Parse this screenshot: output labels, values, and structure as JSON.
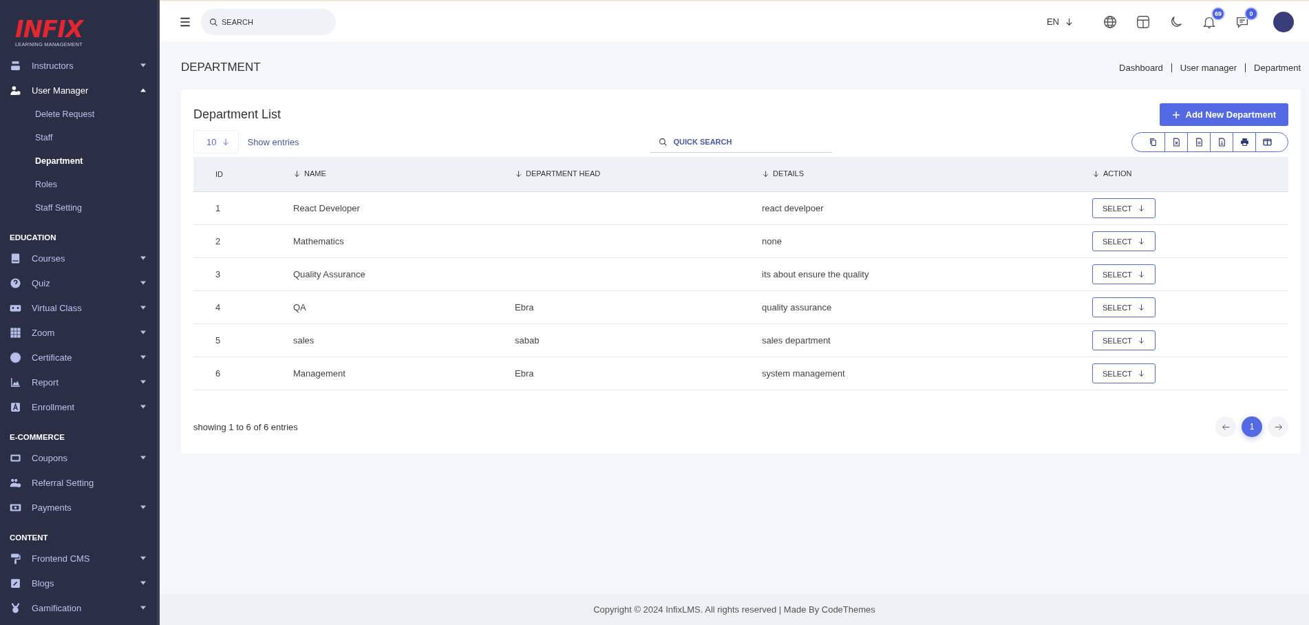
{
  "logo": {
    "title": "INFIX",
    "subtitle": "LEARNING MANAGEMENT"
  },
  "sidebar": {
    "sections": [
      {
        "items": [
          {
            "label": "Instructors",
            "expandable": true,
            "expanded": false
          },
          {
            "label": "User Manager",
            "expandable": true,
            "expanded": true,
            "children": [
              {
                "label": "Delete Request",
                "selected": false
              },
              {
                "label": "Staff",
                "selected": false
              },
              {
                "label": "Department",
                "selected": true
              },
              {
                "label": "Roles",
                "selected": false
              },
              {
                "label": "Staff Setting",
                "selected": false
              }
            ]
          }
        ]
      },
      {
        "title": "EDUCATION",
        "items": [
          {
            "label": "Courses",
            "expandable": true,
            "expanded": false
          },
          {
            "label": "Quiz",
            "expandable": true,
            "expanded": false
          },
          {
            "label": "Virtual Class",
            "expandable": true,
            "expanded": false
          },
          {
            "label": "Zoom",
            "expandable": true,
            "expanded": false
          },
          {
            "label": "Certificate",
            "expandable": true,
            "expanded": false
          },
          {
            "label": "Report",
            "expandable": true,
            "expanded": false
          },
          {
            "label": "Enrollment",
            "expandable": true,
            "expanded": false
          }
        ]
      },
      {
        "title": "E-COMMERCE",
        "items": [
          {
            "label": "Coupons",
            "expandable": true,
            "expanded": false
          },
          {
            "label": "Referral Setting",
            "expandable": false,
            "expanded": false
          },
          {
            "label": "Payments",
            "expandable": true,
            "expanded": false
          }
        ]
      },
      {
        "title": "CONTENT",
        "items": [
          {
            "label": "Frontend CMS",
            "expandable": true,
            "expanded": false
          },
          {
            "label": "Blogs",
            "expandable": true,
            "expanded": false
          },
          {
            "label": "Gamification",
            "expandable": true,
            "expanded": false
          }
        ]
      }
    ]
  },
  "topbar": {
    "search": {
      "placeholder": "SEARCH"
    },
    "language": "EN",
    "notifications_count": "69",
    "messages_count": "0"
  },
  "page": {
    "title": "DEPARTMENT",
    "breadcrumb": [
      "Dashboard",
      "User manager",
      "Department"
    ]
  },
  "card": {
    "title": "Department List",
    "add_button": "Add New Department",
    "page_size": "10",
    "show_entries": "Show entries",
    "quick_search": {
      "placeholder": "QUICK SEARCH"
    },
    "table": {
      "columns": [
        {
          "label": "ID",
          "sortable": false
        },
        {
          "label": "NAME",
          "sortable": true
        },
        {
          "label": "DEPARTMENT HEAD",
          "sortable": true
        },
        {
          "label": "DETAILS",
          "sortable": true
        },
        {
          "label": "ACTION",
          "sortable": true
        }
      ],
      "rows": [
        {
          "id": "1",
          "name": "React Developer",
          "head": "",
          "details": "react develpoer",
          "action": "SELECT"
        },
        {
          "id": "2",
          "name": "Mathematics",
          "head": "",
          "details": "none",
          "action": "SELECT"
        },
        {
          "id": "3",
          "name": "Quality Assurance",
          "head": "",
          "details": "its about ensure the quality",
          "action": "SELECT"
        },
        {
          "id": "4",
          "name": "QA",
          "head": "Ebra",
          "details": "quality assurance",
          "action": "SELECT"
        },
        {
          "id": "5",
          "name": "sales",
          "head": "sabab",
          "details": "sales department",
          "action": "SELECT"
        },
        {
          "id": "6",
          "name": "Management",
          "head": "Ebra",
          "details": "system management",
          "action": "SELECT"
        }
      ]
    },
    "summary": "showing 1 to 6 of 6 entries",
    "pages": [
      {
        "label": "1",
        "selected": true
      }
    ]
  },
  "footer": "Copyright © 2024 InfixLMS. All rights reserved | Made By CodeThemes"
}
